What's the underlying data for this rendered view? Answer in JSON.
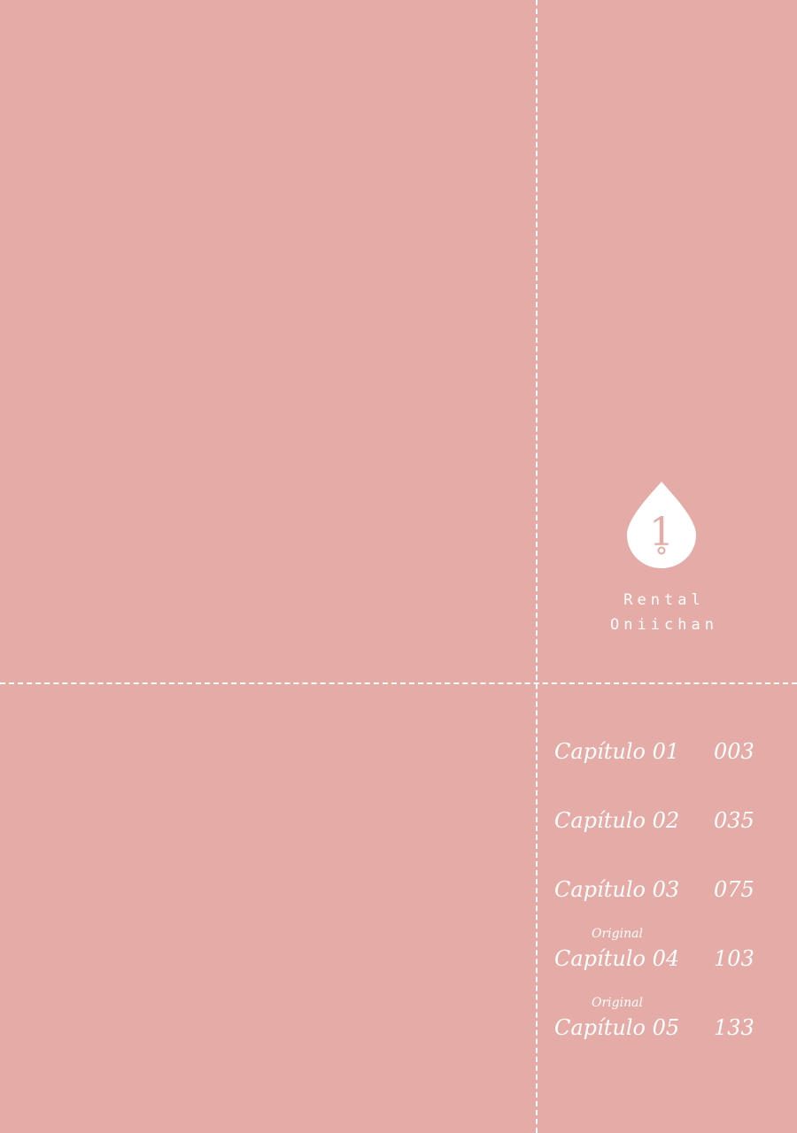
{
  "page": {
    "background_color": "#e5aba6",
    "line_color": "#ffffff"
  },
  "emblem": {
    "icon": "water-drop-icon",
    "number": "1",
    "title_line1": "Rental",
    "title_line2": "Oniichan"
  },
  "toc": {
    "entries": [
      {
        "note": "",
        "label": "Capítulo 01",
        "page": "003"
      },
      {
        "note": "",
        "label": "Capítulo 02",
        "page": "035"
      },
      {
        "note": "",
        "label": "Capítulo 03",
        "page": "075"
      },
      {
        "note": "Original",
        "label": "Capítulo 04",
        "page": "103"
      },
      {
        "note": "Original",
        "label": "Capítulo 05",
        "page": "133"
      }
    ]
  }
}
